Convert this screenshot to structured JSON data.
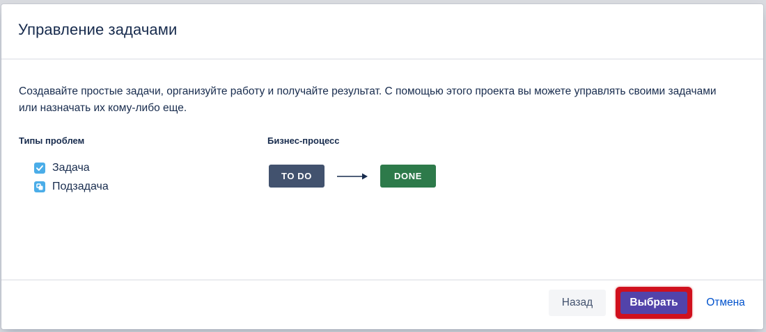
{
  "dialog": {
    "title": "Управление задачами",
    "description": "Создавайте простые задачи, организуйте работу и получайте результат. С помощью этого проекта вы можете управлять своими задачами или назначать их кому-либо еще."
  },
  "issue_types": {
    "heading": "Типы проблем",
    "items": [
      {
        "label": "Задача",
        "icon": "task-checkbox-icon"
      },
      {
        "label": "Подзадача",
        "icon": "subtask-icon"
      }
    ]
  },
  "workflow": {
    "heading": "Бизнес-процесс",
    "statuses": [
      {
        "label": "TO DO",
        "color": "#42526e"
      },
      {
        "label": "DONE",
        "color": "#2d7a4a"
      }
    ]
  },
  "footer": {
    "back_label": "Назад",
    "select_label": "Выбрать",
    "cancel_label": "Отмена"
  },
  "colors": {
    "primary": "#5243aa",
    "link": "#0052cc",
    "highlight": "#d0101d"
  }
}
